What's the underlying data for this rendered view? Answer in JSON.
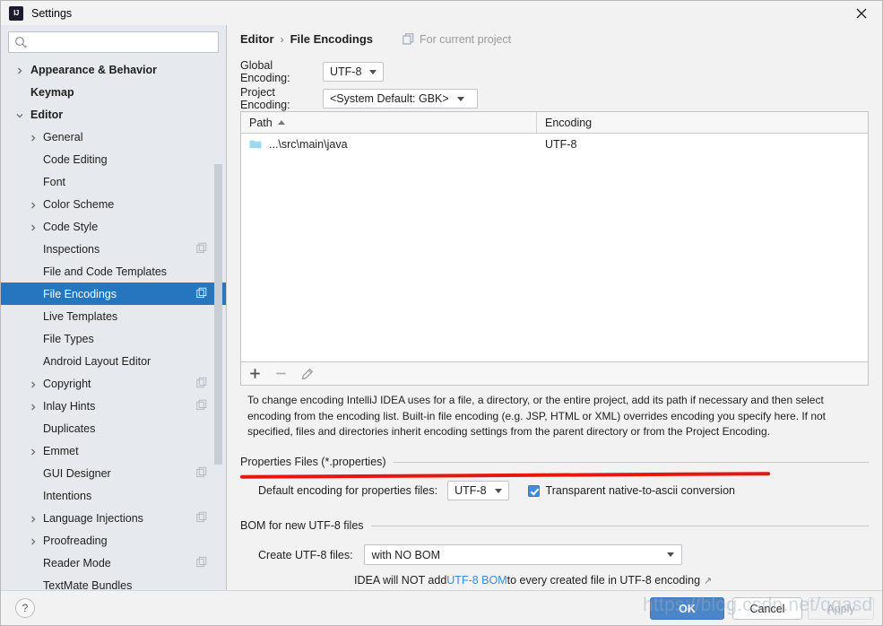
{
  "window": {
    "title": "Settings",
    "logo_icon": "intellij-idea-logo",
    "close_icon": "close-icon"
  },
  "sidebar": {
    "search": {
      "placeholder": "",
      "value": "",
      "icon": "search-icon"
    },
    "items": [
      {
        "label": "Appearance & Behavior",
        "level": 0,
        "arrow": "chevron-right-icon",
        "selected": false,
        "project_icon": false
      },
      {
        "label": "Keymap",
        "level": 0,
        "arrow": "",
        "selected": false,
        "project_icon": false
      },
      {
        "label": "Editor",
        "level": 0,
        "arrow": "chevron-down-icon",
        "selected": false,
        "project_icon": false
      },
      {
        "label": "General",
        "level": 1,
        "arrow": "chevron-right-icon",
        "selected": false,
        "project_icon": false
      },
      {
        "label": "Code Editing",
        "level": 1,
        "arrow": "",
        "selected": false,
        "project_icon": false
      },
      {
        "label": "Font",
        "level": 1,
        "arrow": "",
        "selected": false,
        "project_icon": false
      },
      {
        "label": "Color Scheme",
        "level": 1,
        "arrow": "chevron-right-icon",
        "selected": false,
        "project_icon": false
      },
      {
        "label": "Code Style",
        "level": 1,
        "arrow": "chevron-right-icon",
        "selected": false,
        "project_icon": false
      },
      {
        "label": "Inspections",
        "level": 1,
        "arrow": "",
        "selected": false,
        "project_icon": true
      },
      {
        "label": "File and Code Templates",
        "level": 1,
        "arrow": "",
        "selected": false,
        "project_icon": false
      },
      {
        "label": "File Encodings",
        "level": 1,
        "arrow": "",
        "selected": true,
        "project_icon": true
      },
      {
        "label": "Live Templates",
        "level": 1,
        "arrow": "",
        "selected": false,
        "project_icon": false
      },
      {
        "label": "File Types",
        "level": 1,
        "arrow": "",
        "selected": false,
        "project_icon": false
      },
      {
        "label": "Android Layout Editor",
        "level": 1,
        "arrow": "",
        "selected": false,
        "project_icon": false
      },
      {
        "label": "Copyright",
        "level": 1,
        "arrow": "chevron-right-icon",
        "selected": false,
        "project_icon": true
      },
      {
        "label": "Inlay Hints",
        "level": 1,
        "arrow": "chevron-right-icon",
        "selected": false,
        "project_icon": true
      },
      {
        "label": "Duplicates",
        "level": 1,
        "arrow": "",
        "selected": false,
        "project_icon": false
      },
      {
        "label": "Emmet",
        "level": 1,
        "arrow": "chevron-right-icon",
        "selected": false,
        "project_icon": false
      },
      {
        "label": "GUI Designer",
        "level": 1,
        "arrow": "",
        "selected": false,
        "project_icon": true
      },
      {
        "label": "Intentions",
        "level": 1,
        "arrow": "",
        "selected": false,
        "project_icon": false
      },
      {
        "label": "Language Injections",
        "level": 1,
        "arrow": "chevron-right-icon",
        "selected": false,
        "project_icon": true
      },
      {
        "label": "Proofreading",
        "level": 1,
        "arrow": "chevron-right-icon",
        "selected": false,
        "project_icon": false
      },
      {
        "label": "Reader Mode",
        "level": 1,
        "arrow": "",
        "selected": false,
        "project_icon": true
      },
      {
        "label": "TextMate Bundles",
        "level": 1,
        "arrow": "",
        "selected": false,
        "project_icon": false
      }
    ]
  },
  "main": {
    "breadcrumb": {
      "parent": "Editor",
      "separator": "›",
      "current": "File Encodings"
    },
    "scope_note": {
      "icon": "copy-project-icon",
      "text": "For current project"
    },
    "global_encoding": {
      "label": "Global Encoding:",
      "value": "UTF-8"
    },
    "project_encoding": {
      "label": "Project Encoding:",
      "value": "<System Default: GBK>"
    },
    "table": {
      "columns": [
        "Path",
        "Encoding"
      ],
      "sort_column": "Path",
      "sort_direction": "asc",
      "rows": [
        {
          "icon": "folder-icon",
          "path": "...\\src\\main\\java",
          "encoding": "UTF-8"
        }
      ]
    },
    "table_toolbar": [
      {
        "name": "add-button",
        "icon": "plus-icon"
      },
      {
        "name": "remove-button",
        "icon": "minus-icon"
      },
      {
        "name": "edit-button",
        "icon": "pencil-icon"
      }
    ],
    "description": "To change encoding IntelliJ IDEA uses for a file, a directory, or the entire project, add its path if necessary and then select encoding from the encoding list. Built-in file encoding (e.g. JSP, HTML or XML) overrides encoding you specify here. If not specified, files and directories inherit encoding settings from the parent directory or from the Project Encoding.",
    "properties_section": {
      "title": "Properties Files (*.properties)",
      "default_encoding_label": "Default encoding for properties files:",
      "default_encoding_value": "UTF-8",
      "transparent_conversion_label": "Transparent native-to-ascii conversion",
      "transparent_conversion_checked": true
    },
    "bom_section": {
      "title": "BOM for new UTF-8 files",
      "create_label": "Create UTF-8 files:",
      "create_value": "with NO BOM",
      "hint_prefix": "IDEA will NOT add ",
      "hint_link": "UTF-8 BOM",
      "hint_suffix": " to every created file in UTF-8 encoding",
      "hint_external_icon": "↗"
    }
  },
  "footer": {
    "help_label": "?",
    "ok_label": "OK",
    "cancel_label": "Cancel",
    "apply_label": "Apply"
  },
  "overlay": {
    "watermark": "https://blog.csdn.net/qqasd"
  },
  "colors": {
    "accent_blue": "#2675bf",
    "ok_button": "#4a86c8",
    "link_blue": "#3d8ad6",
    "annotation_red": "#e8170e",
    "sidebar_bg": "#e6eaee",
    "panel_bg": "#f2f2f2"
  }
}
